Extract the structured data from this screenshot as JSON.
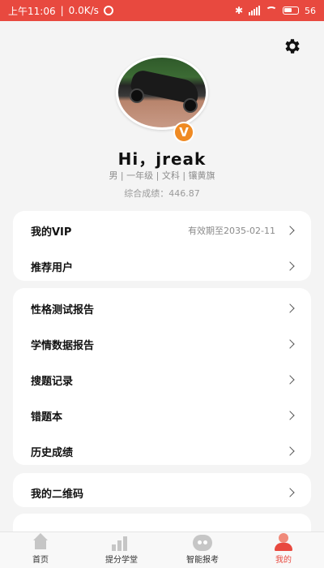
{
  "status_bar": {
    "time": "上午11:06",
    "speed": "0.0K/s",
    "battery": "56"
  },
  "profile": {
    "greeting": "Hi，jreak",
    "info": "男 | 一年级 | 文科 | 镶黄旗",
    "score_label": "综合成绩：446.87",
    "vip_badge": "V"
  },
  "cards": {
    "vip": {
      "my_vip": "我的VIP",
      "vip_expiry": "有效期至2035-02-11",
      "recommend_users": "推荐用户"
    },
    "reports": {
      "personality_report": "性格测试报告",
      "learning_data_report": "学情数据报告",
      "search_history": "搜题记录",
      "mistake_book": "错题本",
      "history_scores": "历史成绩"
    },
    "qr": {
      "my_qrcode": "我的二维码"
    }
  },
  "bottom_nav": {
    "home": "首页",
    "improve": "提分学堂",
    "smart_apply": "智能报考",
    "mine": "我的"
  },
  "colors": {
    "accent": "#e8493f",
    "badge": "#ef8a23"
  }
}
